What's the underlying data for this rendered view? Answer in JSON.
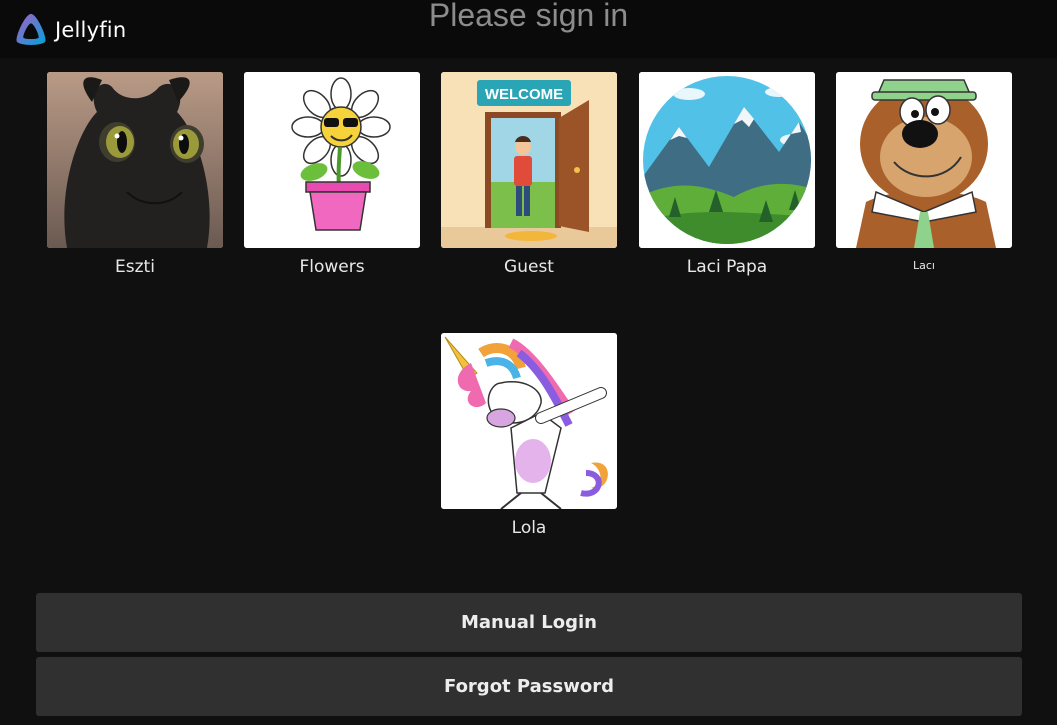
{
  "app": {
    "name": "Jellyfin",
    "page_title": "Please sign in"
  },
  "users": [
    {
      "name": "Eszti",
      "avatar_icon": "dragon-avatar-icon"
    },
    {
      "name": "Flowers",
      "avatar_icon": "flower-avatar-icon"
    },
    {
      "name": "Guest",
      "avatar_icon": "welcome-door-avatar-icon",
      "avatar_text": "WELCOME"
    },
    {
      "name": "Laci Papa",
      "avatar_icon": "mountain-landscape-avatar-icon"
    },
    {
      "name": "Lacı",
      "avatar_icon": "bear-avatar-icon"
    },
    {
      "name": "Lola",
      "avatar_icon": "unicorn-avatar-icon"
    }
  ],
  "actions": {
    "manual_login": "Manual Login",
    "forgot_password": "Forgot Password"
  },
  "colors": {
    "background": "#101010",
    "header": "#0a0a0a",
    "button": "#303030",
    "title": "#8c8c8c",
    "brand_purple": "#aa5cc3",
    "brand_blue": "#00a4dc"
  }
}
